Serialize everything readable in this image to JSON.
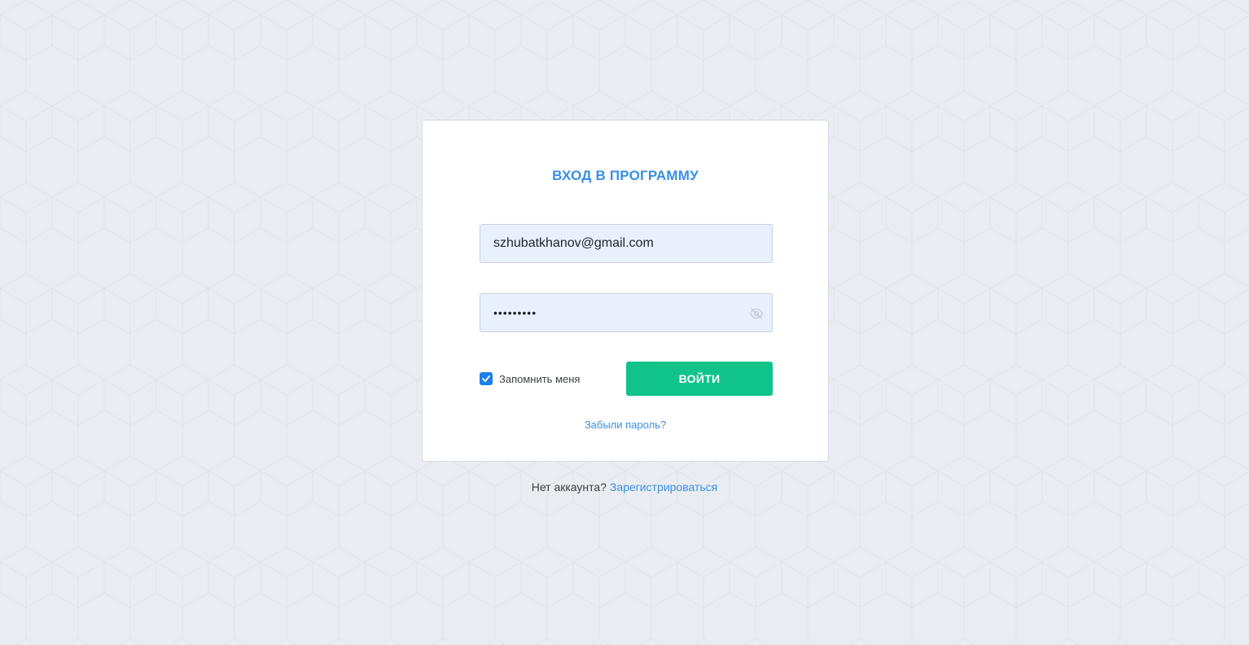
{
  "login": {
    "title": "ВХОД В ПРОГРАММУ",
    "email_value": "szhubatkhanov@gmail.com",
    "password_value": "•••••••••",
    "password_toggle_icon": "eye-off-icon",
    "remember_label": "Запомнить меня",
    "remember_checked": true,
    "submit_label": "ВОЙТИ",
    "forgot_label": "Забыли пароль?"
  },
  "footer": {
    "no_account_text": "Нет аккаунта?",
    "register_label": "Зарегистрироваться"
  },
  "colors": {
    "accent": "#3a8ee6",
    "primary_button": "#10c38a",
    "checkbox": "#1a7fea",
    "input_background": "#e8f0fe",
    "page_background": "#e9edf1"
  }
}
